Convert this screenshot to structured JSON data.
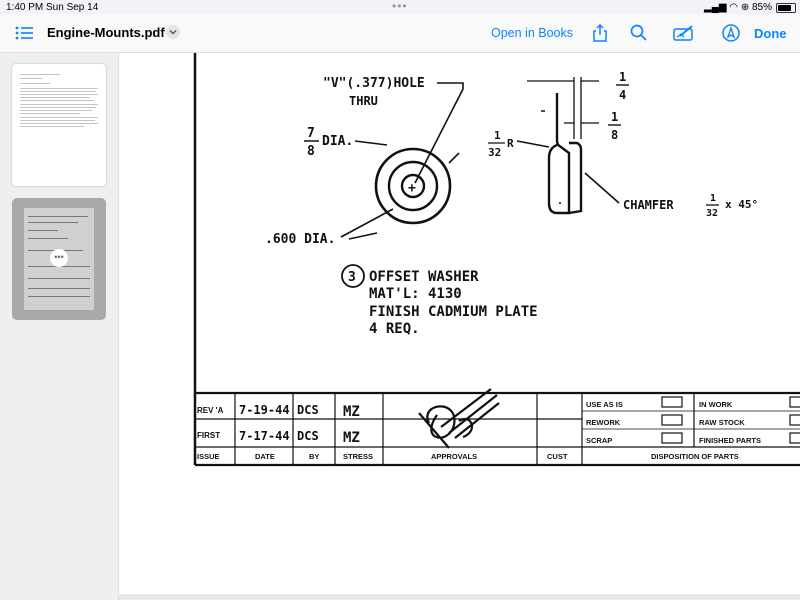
{
  "status_bar": {
    "time": "1:40 PM",
    "date": "Sun Sep 14",
    "battery": "85%"
  },
  "toolbar": {
    "title": "Engine-Mounts.pdf",
    "open_in_books": "Open in Books",
    "done": "Done"
  },
  "icons": [
    "sidebar-list-icon",
    "chevron-down-icon",
    "share-icon",
    "search-icon",
    "markup-icon",
    "navigate-icon"
  ],
  "drawing": {
    "hole_note": "\"V\"(.377)HOLE",
    "thru": "THRU",
    "dia_frac_num": "7",
    "dia_frac_den": "8",
    "dia_label": "DIA.",
    "small_dia": ".600 DIA.",
    "radius_num": "1",
    "radius_den": "32",
    "radius_r": "R",
    "thick1_num": "1",
    "thick1_den": "4",
    "thick2_num": "1",
    "thick2_den": "8",
    "chamfer": "CHAMFER",
    "chamfer_num": "1",
    "chamfer_den": "32",
    "chamfer_angle": "x 45°",
    "part_number": "3",
    "part_name": "OFFSET WASHER",
    "material": "MAT'L: 4130",
    "finish": "FINISH  CADMIUM  PLATE",
    "quantity": "4 REQ."
  },
  "title_block": {
    "rows": [
      {
        "issue": "REV 'A",
        "date": "7-19-44",
        "by": "DCS",
        "stress": "MZ"
      },
      {
        "issue": "FIRST",
        "date": "7-17-44",
        "by": "DCS",
        "stress": "MZ"
      }
    ],
    "headers": {
      "issue": "ISSUE",
      "date": "DATE",
      "by": "BY",
      "stress": "STRESS",
      "approvals": "APPROVALS",
      "cust": "CUST"
    },
    "disposition": {
      "left": [
        "USE AS IS",
        "REWORK",
        "SCRAP"
      ],
      "right": [
        "IN WORK",
        "RAW STOCK",
        "FINISHED PARTS"
      ],
      "footer": "DISPOSITION OF PARTS"
    }
  }
}
